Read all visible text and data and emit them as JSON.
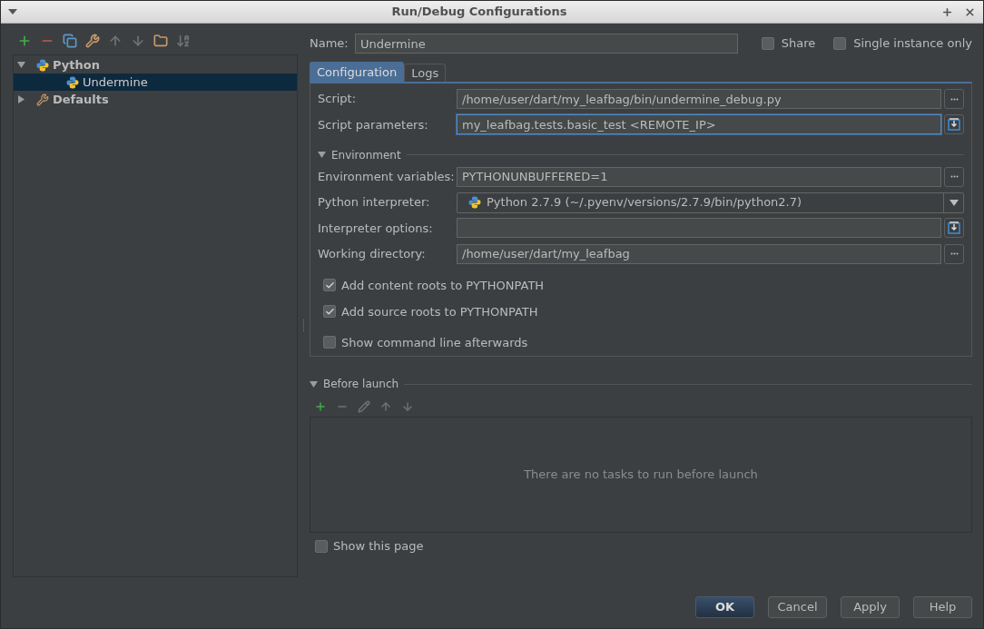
{
  "window": {
    "title": "Run/Debug Configurations"
  },
  "tree": [
    {
      "label": "Python",
      "expanded": true,
      "selected": false,
      "kind": "type",
      "children": [
        {
          "label": "Undermine",
          "selected": true,
          "kind": "config"
        }
      ]
    },
    {
      "label": "Defaults",
      "expanded": false,
      "selected": false,
      "kind": "defaults"
    }
  ],
  "name_field": {
    "label": "Name:",
    "value": "Undermine"
  },
  "header_options": [
    {
      "label": "Share",
      "checked": false
    },
    {
      "label": "Single instance only",
      "checked": false
    }
  ],
  "tabs": [
    {
      "label": "Configuration",
      "selected": true
    },
    {
      "label": "Logs",
      "selected": false
    }
  ],
  "fields": [
    {
      "label": "Script:",
      "value": "/home/user/dart/my_leafbag/bin/undermine_debug.py",
      "kind": "browse",
      "focused": false
    },
    {
      "label": "Script parameters:",
      "value": "my_leafbag.tests.basic_test <REMOTE_IP>",
      "kind": "expand",
      "focused": true
    }
  ],
  "environment": {
    "title": "Environment",
    "expanded": true,
    "fields": [
      {
        "label": "Environment variables:",
        "value": "PYTHONUNBUFFERED=1",
        "kind": "browse",
        "focused": false
      },
      {
        "label": "Python interpreter:",
        "value": "Python 2.7.9 (~/.pyenv/versions/2.7.9/bin/python2.7)",
        "kind": "dropdown",
        "focused": false
      },
      {
        "label": "Interpreter options:",
        "kind": "expand",
        "focused": false
      },
      {
        "label": "Working directory:",
        "value": "/home/user/dart/my_leafbag",
        "kind": "browse",
        "focused": false
      }
    ]
  },
  "options": [
    {
      "label": "Add content roots to PYTHONPATH",
      "checked": true
    },
    {
      "label": "Add source roots to PYTHONPATH",
      "checked": true
    },
    {
      "label": "Show command line afterwards",
      "checked": false
    }
  ],
  "before_launch": {
    "title": "Before launch",
    "expanded": true,
    "empty_text": "There are no tasks to run before launch"
  },
  "show_page": {
    "label": "Show this page",
    "checked": false
  },
  "buttons": [
    {
      "label": "OK",
      "primary": true
    },
    {
      "label": "Cancel",
      "primary": false
    },
    {
      "label": "Apply",
      "primary": false
    },
    {
      "label": "Help",
      "primary": false
    }
  ]
}
